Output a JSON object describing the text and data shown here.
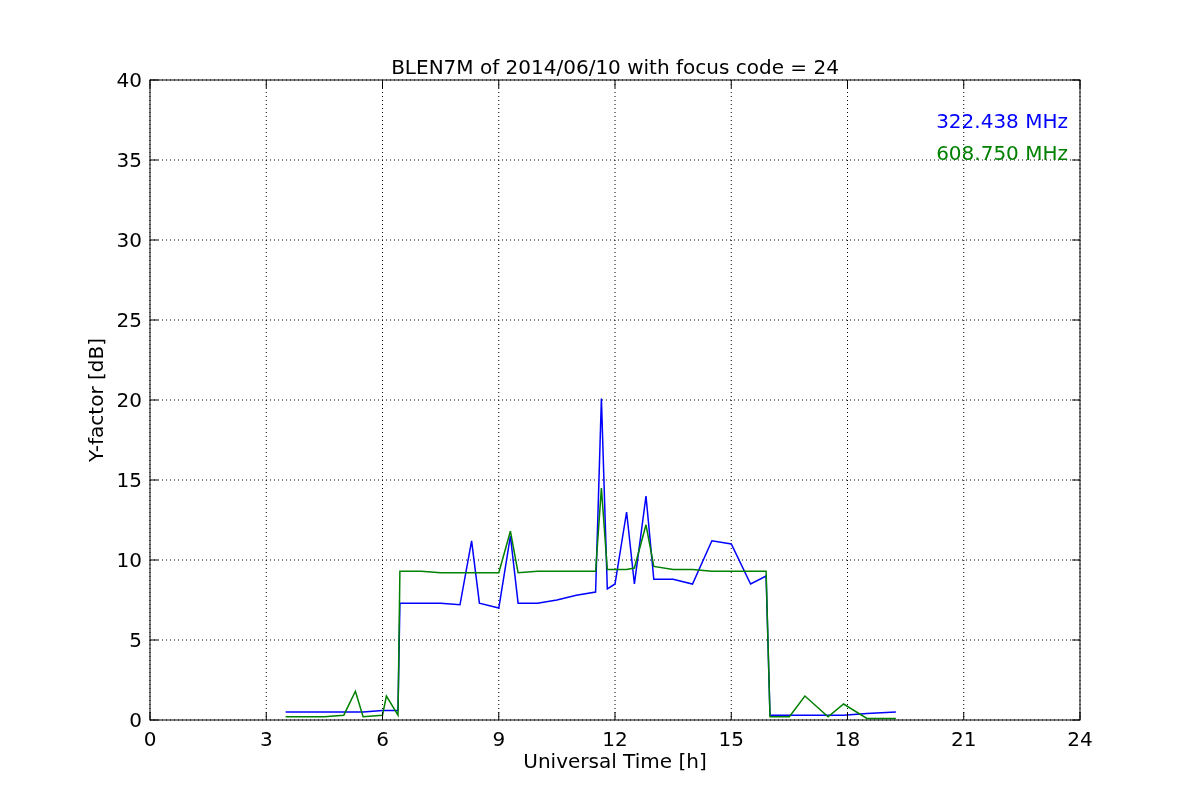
{
  "chart_data": {
    "type": "line",
    "title": "BLEN7M of 2014/06/10 with focus code = 24",
    "xlabel": "Universal Time [h]",
    "ylabel": "Y-factor [dB]",
    "x": [
      3.5,
      4,
      4.5,
      5,
      5.3,
      5.5,
      6,
      6.1,
      6.4,
      6.45,
      7,
      7.5,
      8,
      8.3,
      8.5,
      9,
      9.3,
      9.5,
      10,
      10.5,
      11,
      11.5,
      11.65,
      11.8,
      12,
      12.3,
      12.5,
      12.8,
      13,
      13.5,
      14,
      14.5,
      15,
      15.5,
      15.9,
      16,
      16.5,
      16.9,
      17.5,
      17.9,
      18.5,
      19.25
    ],
    "series": [
      {
        "name": "322.438 MHz",
        "color": "#0000ff",
        "values": [
          0.5,
          0.5,
          0.5,
          0.5,
          0.5,
          0.5,
          0.6,
          0.6,
          0.6,
          7.3,
          7.3,
          7.3,
          7.2,
          11.2,
          7.3,
          7.0,
          11.5,
          7.3,
          7.3,
          7.5,
          7.8,
          8.0,
          20.1,
          8.2,
          8.5,
          13,
          8.5,
          14,
          8.8,
          8.8,
          8.5,
          11.2,
          11,
          8.5,
          9,
          0.3,
          0.3,
          0.3,
          0.3,
          0.3,
          0.4,
          0.5
        ]
      },
      {
        "name": "608.750 MHz",
        "color": "#008000",
        "values": [
          0.2,
          0.2,
          0.2,
          0.3,
          1.8,
          0.2,
          0.3,
          1.5,
          0.3,
          9.3,
          9.3,
          9.2,
          9.2,
          9.2,
          9.2,
          9.2,
          11.8,
          9.2,
          9.3,
          9.3,
          9.3,
          9.3,
          14.5,
          9.4,
          9.4,
          9.4,
          9.5,
          12.2,
          9.6,
          9.4,
          9.4,
          9.3,
          9.3,
          9.3,
          9.3,
          0.2,
          0.2,
          1.5,
          0.2,
          1.0,
          0.1,
          0.1
        ]
      }
    ],
    "xlim": [
      0,
      24
    ],
    "ylim": [
      0,
      40
    ],
    "xticks": [
      0,
      3,
      6,
      9,
      12,
      15,
      18,
      21,
      24
    ],
    "yticks": [
      0,
      5,
      10,
      15,
      20,
      25,
      30,
      35,
      40
    ],
    "grid": true
  }
}
